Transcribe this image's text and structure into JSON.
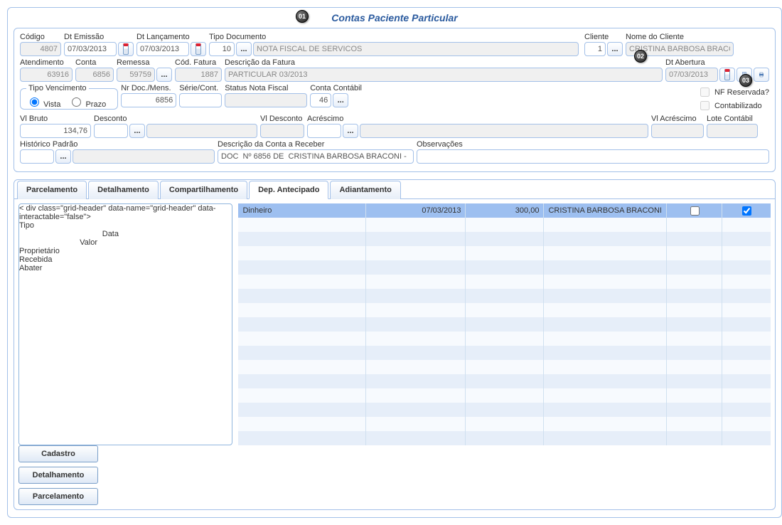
{
  "title": "Contas Paciente Particular",
  "labels": {
    "codigo": "Código",
    "dt_emissao": "Dt Emissão",
    "dt_lancamento": "Dt Lançamento",
    "tipo_doc": "Tipo Documento",
    "cliente": "Cliente",
    "nome_cliente": "Nome do Cliente",
    "atendimento": "Atendimento",
    "conta": "Conta",
    "remessa": "Remessa",
    "cod_fatura": "Cód. Fatura",
    "descricao_fatura": "Descrição da Fatura",
    "dt_abertura": "Dt Abertura",
    "tipo_venc": "Tipo Vencimento",
    "vista": "Vista",
    "prazo": "Prazo",
    "nr_doc_mens": "Nr Doc./Mens.",
    "serie_cont": "Série/Cont.",
    "status_nf": "Status Nota Fiscal",
    "conta_contabil": "Conta Contábil",
    "nf_reservada": "NF Reservada?",
    "contabilizado": "Contabilizado",
    "vl_bruto": "Vl Bruto",
    "desconto": "Desconto",
    "vl_desconto": "Vl Desconto",
    "acrescimo": "Acréscimo",
    "vl_acrescimo": "Vl Acréscimo",
    "lote_contabil": "Lote Contábil",
    "historico_padrao": "Histórico Padrão",
    "descricao_conta_receber": "Descrição da Conta a Receber",
    "observacoes": "Observações"
  },
  "values": {
    "codigo": "4807",
    "dt_emissao": "07/03/2013",
    "dt_lancamento": "07/03/2013",
    "tipo_doc_code": "10",
    "tipo_doc_desc": "NOTA FISCAL DE SERVICOS",
    "cliente_code": "1",
    "nome_cliente": "CRISTINA BARBOSA BRACC",
    "atendimento": "63916",
    "conta": "6856",
    "remessa": "59759",
    "cod_fatura": "1887",
    "descricao_fatura": "PARTICULAR 03/2013",
    "dt_abertura": "07/03/2013",
    "nr_doc_mens": "6856",
    "conta_contabil": "46",
    "vl_bruto": "134,76",
    "descricao_conta_receber": "DOC  Nº 6856 DE  CRISTINA BARBOSA BRACONI -"
  },
  "tabs": [
    "Parcelamento",
    "Detalhamento",
    "Compartilhamento",
    "Dep. Antecipado",
    "Adiantamento"
  ],
  "active_tab": "Dep. Antecipado",
  "grid": {
    "headers": {
      "tipo": "Tipo",
      "data": "Data",
      "valor": "Valor",
      "proprietario": "Proprietário",
      "recebida": "Recebida",
      "abater": "Abater"
    },
    "rows": [
      {
        "tipo": "Dinheiro",
        "data": "07/03/2013",
        "valor": "300,00",
        "proprietario": "CRISTINA BARBOSA BRACONI",
        "recebida": false,
        "abater": true
      }
    ]
  },
  "side_buttons": [
    "Cadastro",
    "Detalhamento",
    "Parcelamento"
  ],
  "badges": {
    "01": "01",
    "02": "02",
    "03": "03"
  }
}
